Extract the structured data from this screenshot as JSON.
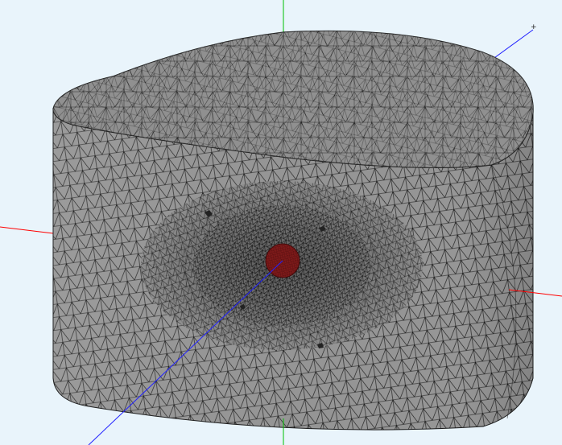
{
  "viewport": {
    "background": "#e9f4fb",
    "mode": "3d-mesh-view",
    "zoom_level": ""
  },
  "mesh": {
    "element_type": "tetrahedral",
    "shape": "rounded cylinder block",
    "surface_color": "#8f8f8f",
    "edge_color": "#1a1a1a",
    "highlight_color": "#7a1e1e"
  },
  "axes": {
    "x": {
      "color": "#ff0000",
      "label": ""
    },
    "y": {
      "color": "#00c000",
      "label": ""
    },
    "z": {
      "color": "#2020ff",
      "label": "+"
    }
  },
  "icons": {
    "axis_tick": "plus-sign-icon"
  }
}
